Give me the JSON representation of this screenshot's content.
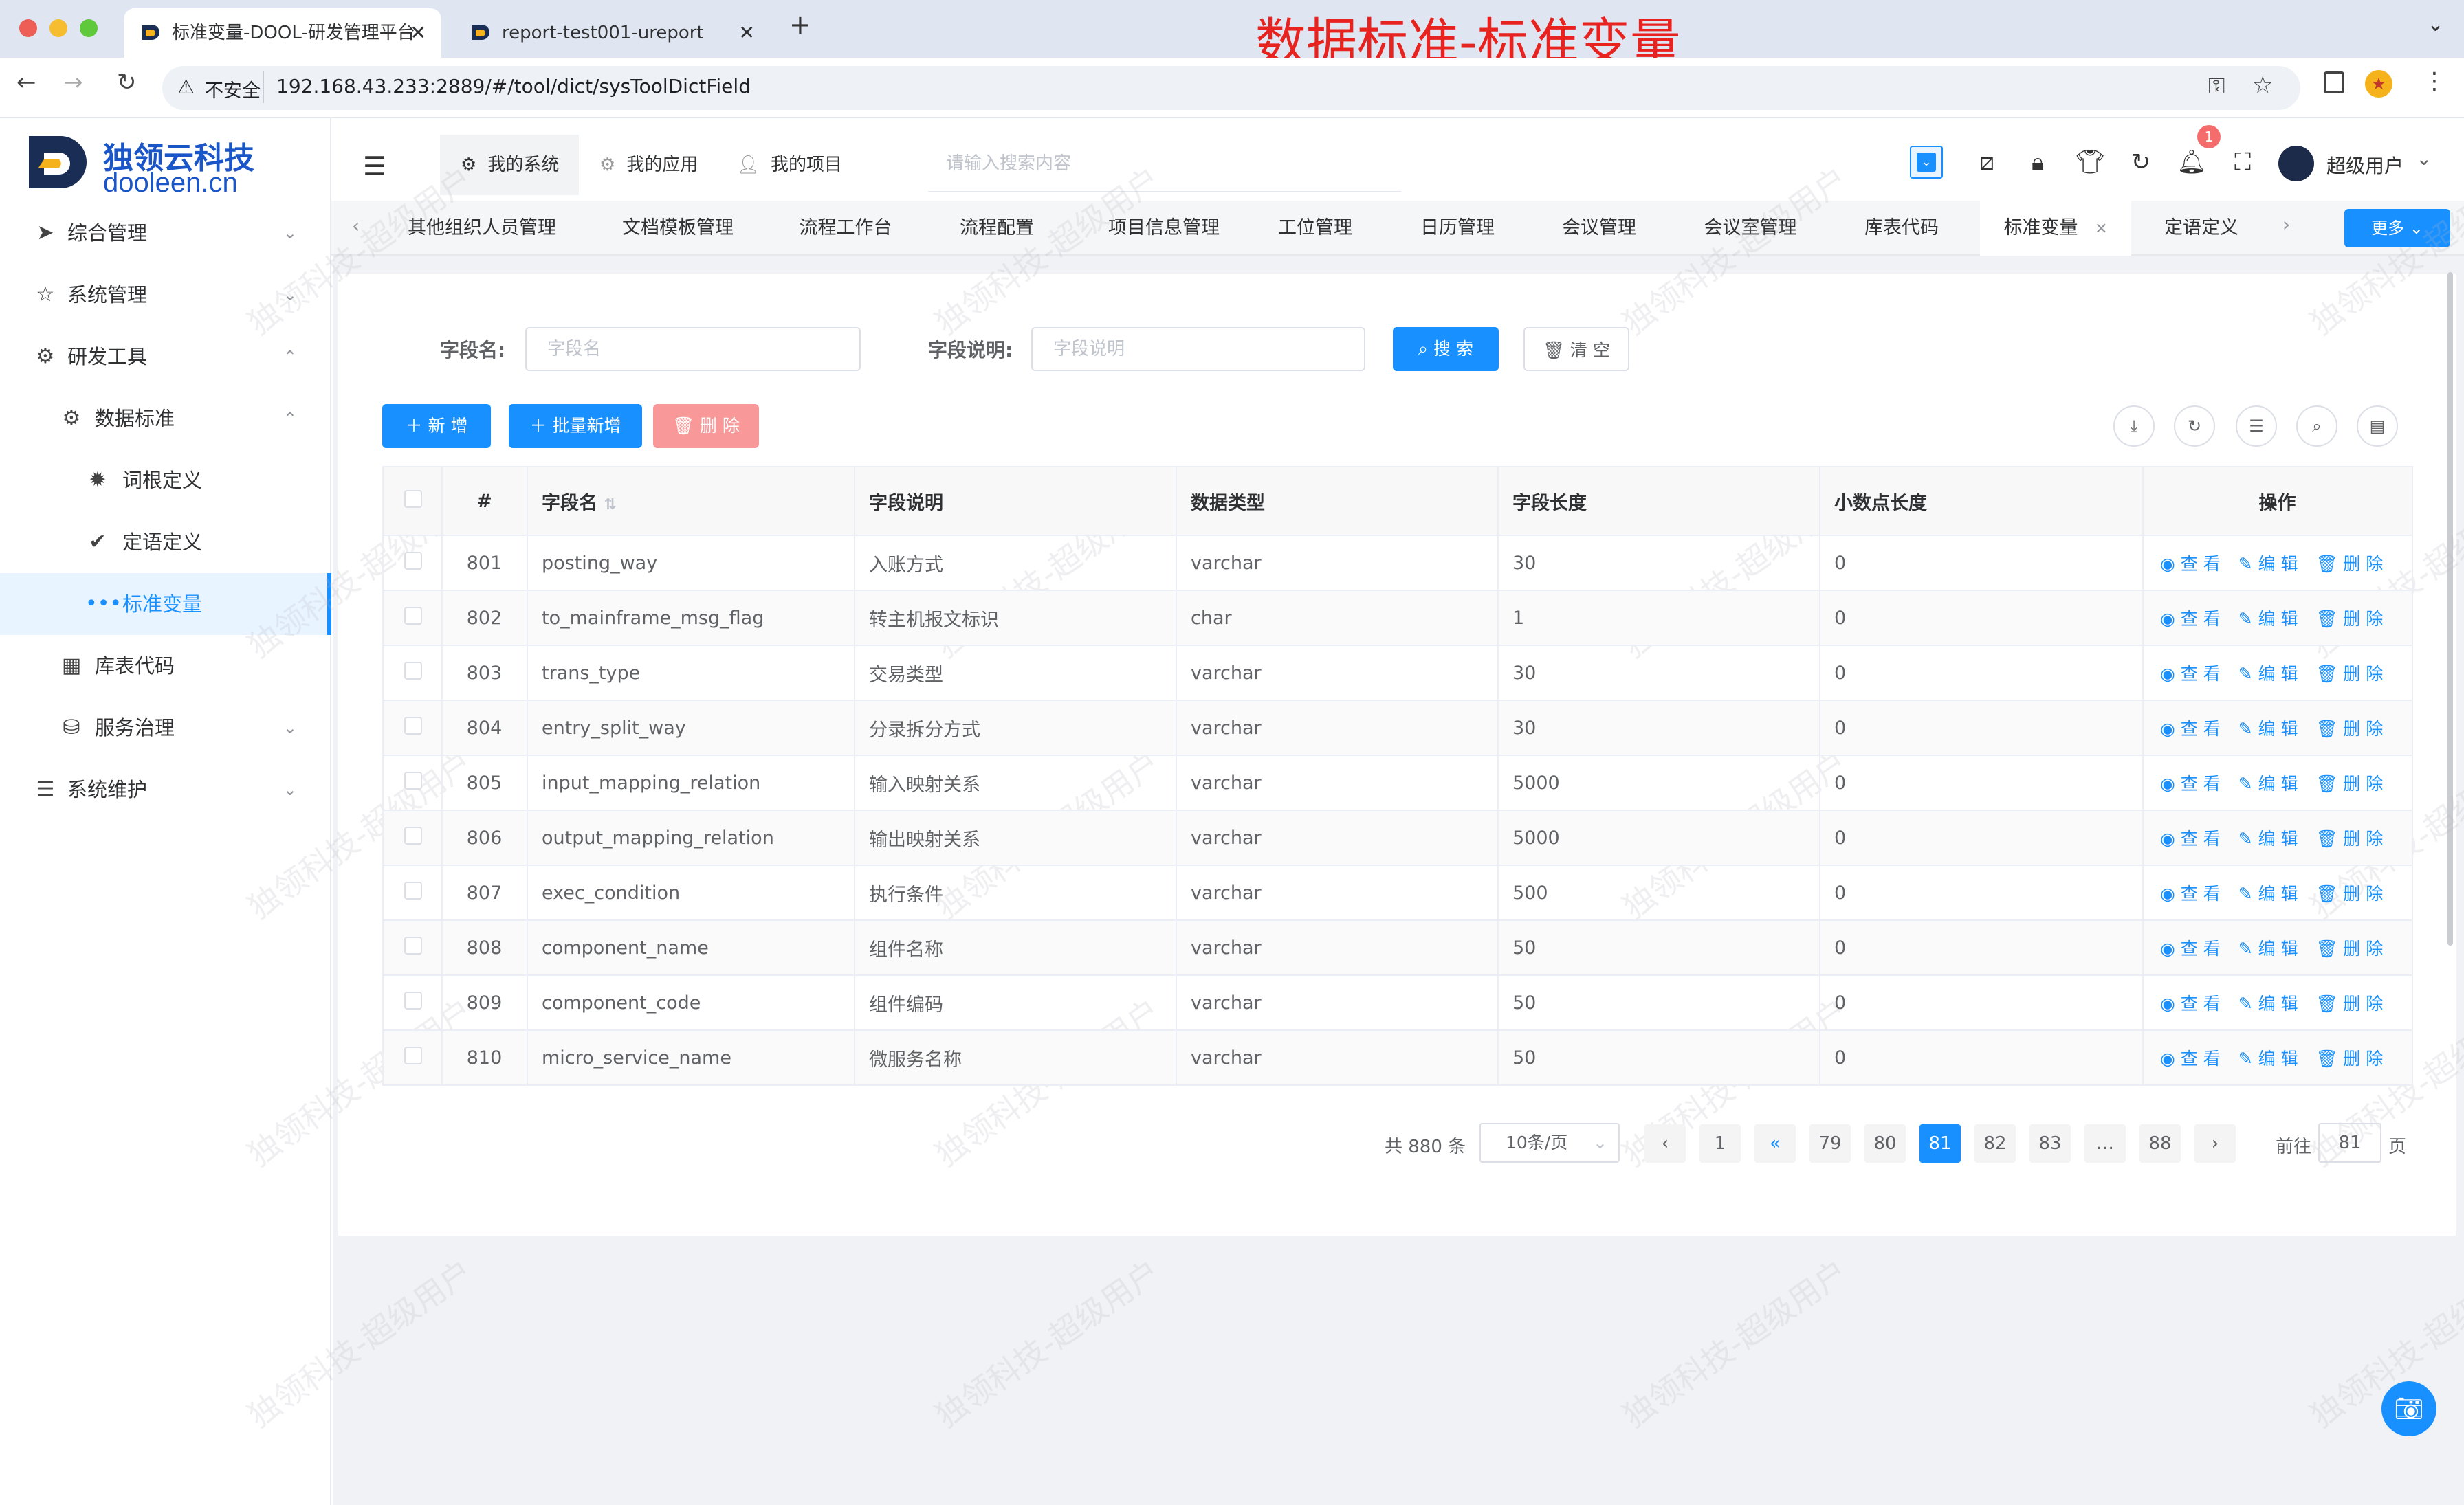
{
  "browser": {
    "tabs": [
      {
        "title": "标准变量-DOOL-研发管理平台",
        "active": true
      },
      {
        "title": "report-test001-ureport",
        "active": false
      }
    ],
    "security_label": "不安全",
    "url": "192.168.43.233:2889/#/tool/dict/sysToolDictField"
  },
  "overlay_title": "数据标准-标准变量",
  "logo": {
    "name": "独领云科技",
    "domain": "dooleen.cn"
  },
  "sidebar": {
    "items": [
      {
        "label": "综合管理",
        "icon": "send-icon",
        "chevron": "⌄"
      },
      {
        "label": "系统管理",
        "icon": "star-icon",
        "chevron": "⌄"
      },
      {
        "label": "研发工具",
        "icon": "gear-icon",
        "chevron": "⌃"
      },
      {
        "label": "数据标准",
        "icon": "gear-icon",
        "chevron": "⌃"
      },
      {
        "label": "词根定义",
        "icon": "cog-filled-icon",
        "chevron": ""
      },
      {
        "label": "定语定义",
        "icon": "check-circle-icon",
        "chevron": ""
      },
      {
        "label": "标准变量",
        "icon": "dots-icon",
        "chevron": ""
      },
      {
        "label": "库表代码",
        "icon": "grid-icon",
        "chevron": ""
      },
      {
        "label": "服务治理",
        "icon": "database-icon",
        "chevron": "⌄"
      },
      {
        "label": "系统维护",
        "icon": "sliders-icon",
        "chevron": "⌄"
      }
    ]
  },
  "header": {
    "tabs": [
      "我的系统",
      "我的应用",
      "我的项目"
    ],
    "search_placeholder": "请输入搜索内容",
    "notification_count": "1",
    "username": "超级用户"
  },
  "page_tabs": [
    "其他组织人员管理",
    "文档模板管理",
    "流程工作台",
    "流程配置",
    "项目信息管理",
    "工位管理",
    "日历管理",
    "会议管理",
    "会议室管理",
    "库表代码",
    "标准变量",
    "定语定义"
  ],
  "more_label": "更多",
  "filters": {
    "field_name_label": "字段名:",
    "field_name_placeholder": "字段名",
    "field_desc_label": "字段说明:",
    "field_desc_placeholder": "字段说明",
    "search_label": "搜 索",
    "clear_label": "清 空"
  },
  "toolbar": {
    "add_label": "新 增",
    "batch_add_label": "批量新增",
    "delete_label": "删 除"
  },
  "table": {
    "headers": [
      "#",
      "字段名",
      "字段说明",
      "数据类型",
      "字段长度",
      "小数点长度",
      "操作"
    ],
    "rows": [
      [
        "801",
        "posting_way",
        "入账方式",
        "varchar",
        "30",
        "0"
      ],
      [
        "802",
        "to_mainframe_msg_flag",
        "转主机报文标识",
        "char",
        "1",
        "0"
      ],
      [
        "803",
        "trans_type",
        "交易类型",
        "varchar",
        "30",
        "0"
      ],
      [
        "804",
        "entry_split_way",
        "分录拆分方式",
        "varchar",
        "30",
        "0"
      ],
      [
        "805",
        "input_mapping_relation",
        "输入映射关系",
        "varchar",
        "5000",
        "0"
      ],
      [
        "806",
        "output_mapping_relation",
        "输出映射关系",
        "varchar",
        "5000",
        "0"
      ],
      [
        "807",
        "exec_condition",
        "执行条件",
        "varchar",
        "500",
        "0"
      ],
      [
        "808",
        "component_name",
        "组件名称",
        "varchar",
        "50",
        "0"
      ],
      [
        "809",
        "component_code",
        "组件编码",
        "varchar",
        "50",
        "0"
      ],
      [
        "810",
        "micro_service_name",
        "微服务名称",
        "varchar",
        "50",
        "0"
      ]
    ],
    "actions": [
      "查 看",
      "编 辑",
      "删 除"
    ]
  },
  "pagination": {
    "total": "共 880 条",
    "page_size": "10条/页",
    "pages": [
      "1",
      "«",
      "79",
      "80",
      "81",
      "82",
      "83",
      "…",
      "88"
    ],
    "current": "81",
    "goto_label": "前往",
    "goto_value": "81",
    "page_suffix": "页"
  },
  "watermark": "独领科技-超级用户",
  "colors": {
    "primary": "#1890ff",
    "danger": "#f56c6c",
    "overlay_title": "#e8231f"
  }
}
